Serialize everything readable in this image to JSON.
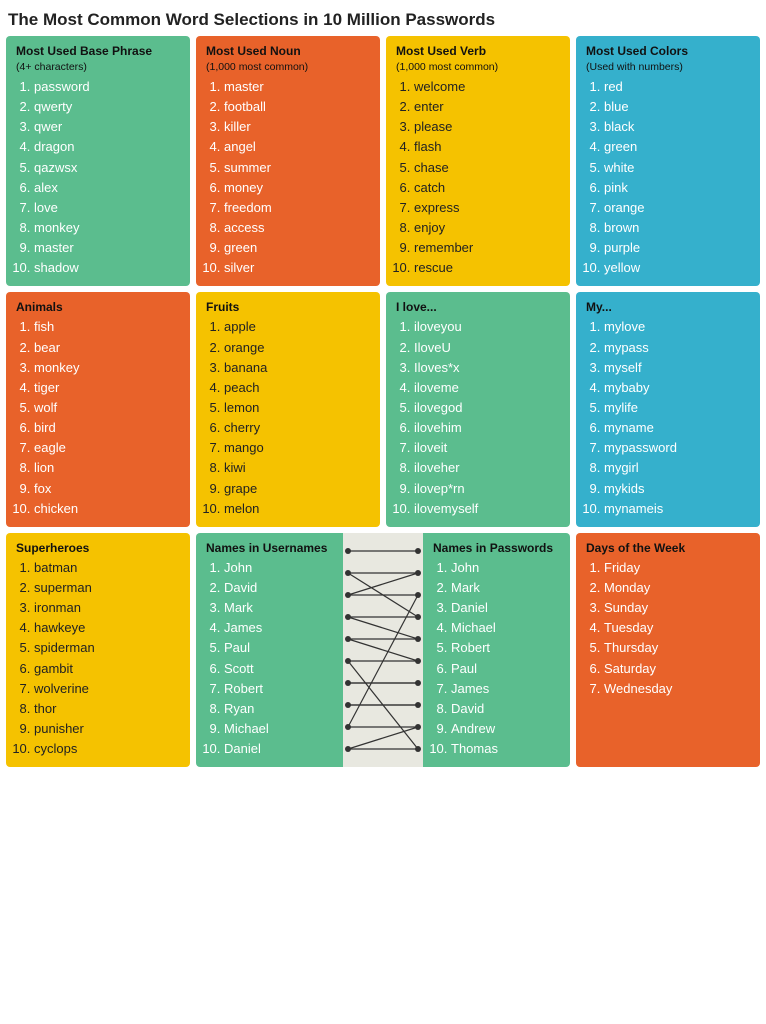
{
  "title": "The Most Common Word Selections in 10 Million Passwords",
  "sections": {
    "base_phrase": {
      "header": "Most Used Base Phrase",
      "subheader": "(4+ characters)",
      "color": "col-green",
      "items": [
        "password",
        "qwerty",
        "qwer",
        "dragon",
        "qazwsx",
        "alex",
        "love",
        "monkey",
        "master",
        "shadow"
      ]
    },
    "noun": {
      "header": "Most Used Noun",
      "subheader": "(1,000 most common)",
      "color": "col-orange",
      "items": [
        "master",
        "football",
        "killer",
        "angel",
        "summer",
        "money",
        "freedom",
        "access",
        "green",
        "silver"
      ]
    },
    "verb": {
      "header": "Most Used Verb",
      "subheader": "(1,000 most common)",
      "color": "col-yellow",
      "items": [
        "welcome",
        "enter",
        "please",
        "flash",
        "chase",
        "catch",
        "express",
        "enjoy",
        "remember",
        "rescue"
      ]
    },
    "colors": {
      "header": "Most Used Colors",
      "subheader": "(Used with numbers)",
      "color": "col-blue",
      "items": [
        "red",
        "blue",
        "black",
        "green",
        "white",
        "pink",
        "orange",
        "brown",
        "purple",
        "yellow"
      ]
    },
    "animals": {
      "header": "Animals",
      "color": "col-orange",
      "items": [
        "fish",
        "bear",
        "monkey",
        "tiger",
        "wolf",
        "bird",
        "eagle",
        "lion",
        "fox",
        "chicken"
      ]
    },
    "fruits": {
      "header": "Fruits",
      "color": "col-yellow",
      "items": [
        "apple",
        "orange",
        "banana",
        "peach",
        "lemon",
        "cherry",
        "mango",
        "kiwi",
        "grape",
        "melon"
      ]
    },
    "ilove": {
      "header": "I love...",
      "color": "col-green",
      "items": [
        "iloveyou",
        "IloveU",
        "Iloves*x",
        "iloveme",
        "ilovegod",
        "ilovehim",
        "iloveit",
        "iloveher",
        "ilovep*rn",
        "ilovemyself"
      ]
    },
    "my": {
      "header": "My...",
      "color": "col-blue",
      "items": [
        "mylove",
        "mypass",
        "myself",
        "mybaby",
        "mylife",
        "myname",
        "mypassword",
        "mygirl",
        "mykids",
        "mynameis"
      ]
    },
    "superheroes": {
      "header": "Superheroes",
      "color": "col-yellow",
      "items": [
        "batman",
        "superman",
        "ironman",
        "hawkeye",
        "spiderman",
        "gambit",
        "wolverine",
        "thor",
        "punisher",
        "cyclops"
      ]
    },
    "names_usernames": {
      "header": "Names in Usernames",
      "color": "col-green",
      "items": [
        "John",
        "David",
        "Mark",
        "James",
        "Paul",
        "Scott",
        "Robert",
        "Ryan",
        "Michael",
        "Daniel"
      ]
    },
    "names_passwords": {
      "header": "Names in Passwords",
      "color": "col-green",
      "items": [
        "John",
        "Mark",
        "Daniel",
        "Michael",
        "Robert",
        "Paul",
        "James",
        "David",
        "Andrew",
        "Thomas"
      ]
    },
    "days": {
      "header": "Days of the Week",
      "color": "col-orange",
      "items": [
        "Friday",
        "Monday",
        "Sunday",
        "Tuesday",
        "Thursday",
        "Saturday",
        "Wednesday"
      ]
    }
  },
  "lines": [
    [
      0,
      0
    ],
    [
      1,
      3
    ],
    [
      2,
      1
    ],
    [
      3,
      5
    ],
    [
      4,
      4
    ],
    [
      5,
      6
    ],
    [
      6,
      2
    ],
    [
      7,
      7
    ],
    [
      8,
      8
    ],
    [
      9,
      9
    ]
  ]
}
